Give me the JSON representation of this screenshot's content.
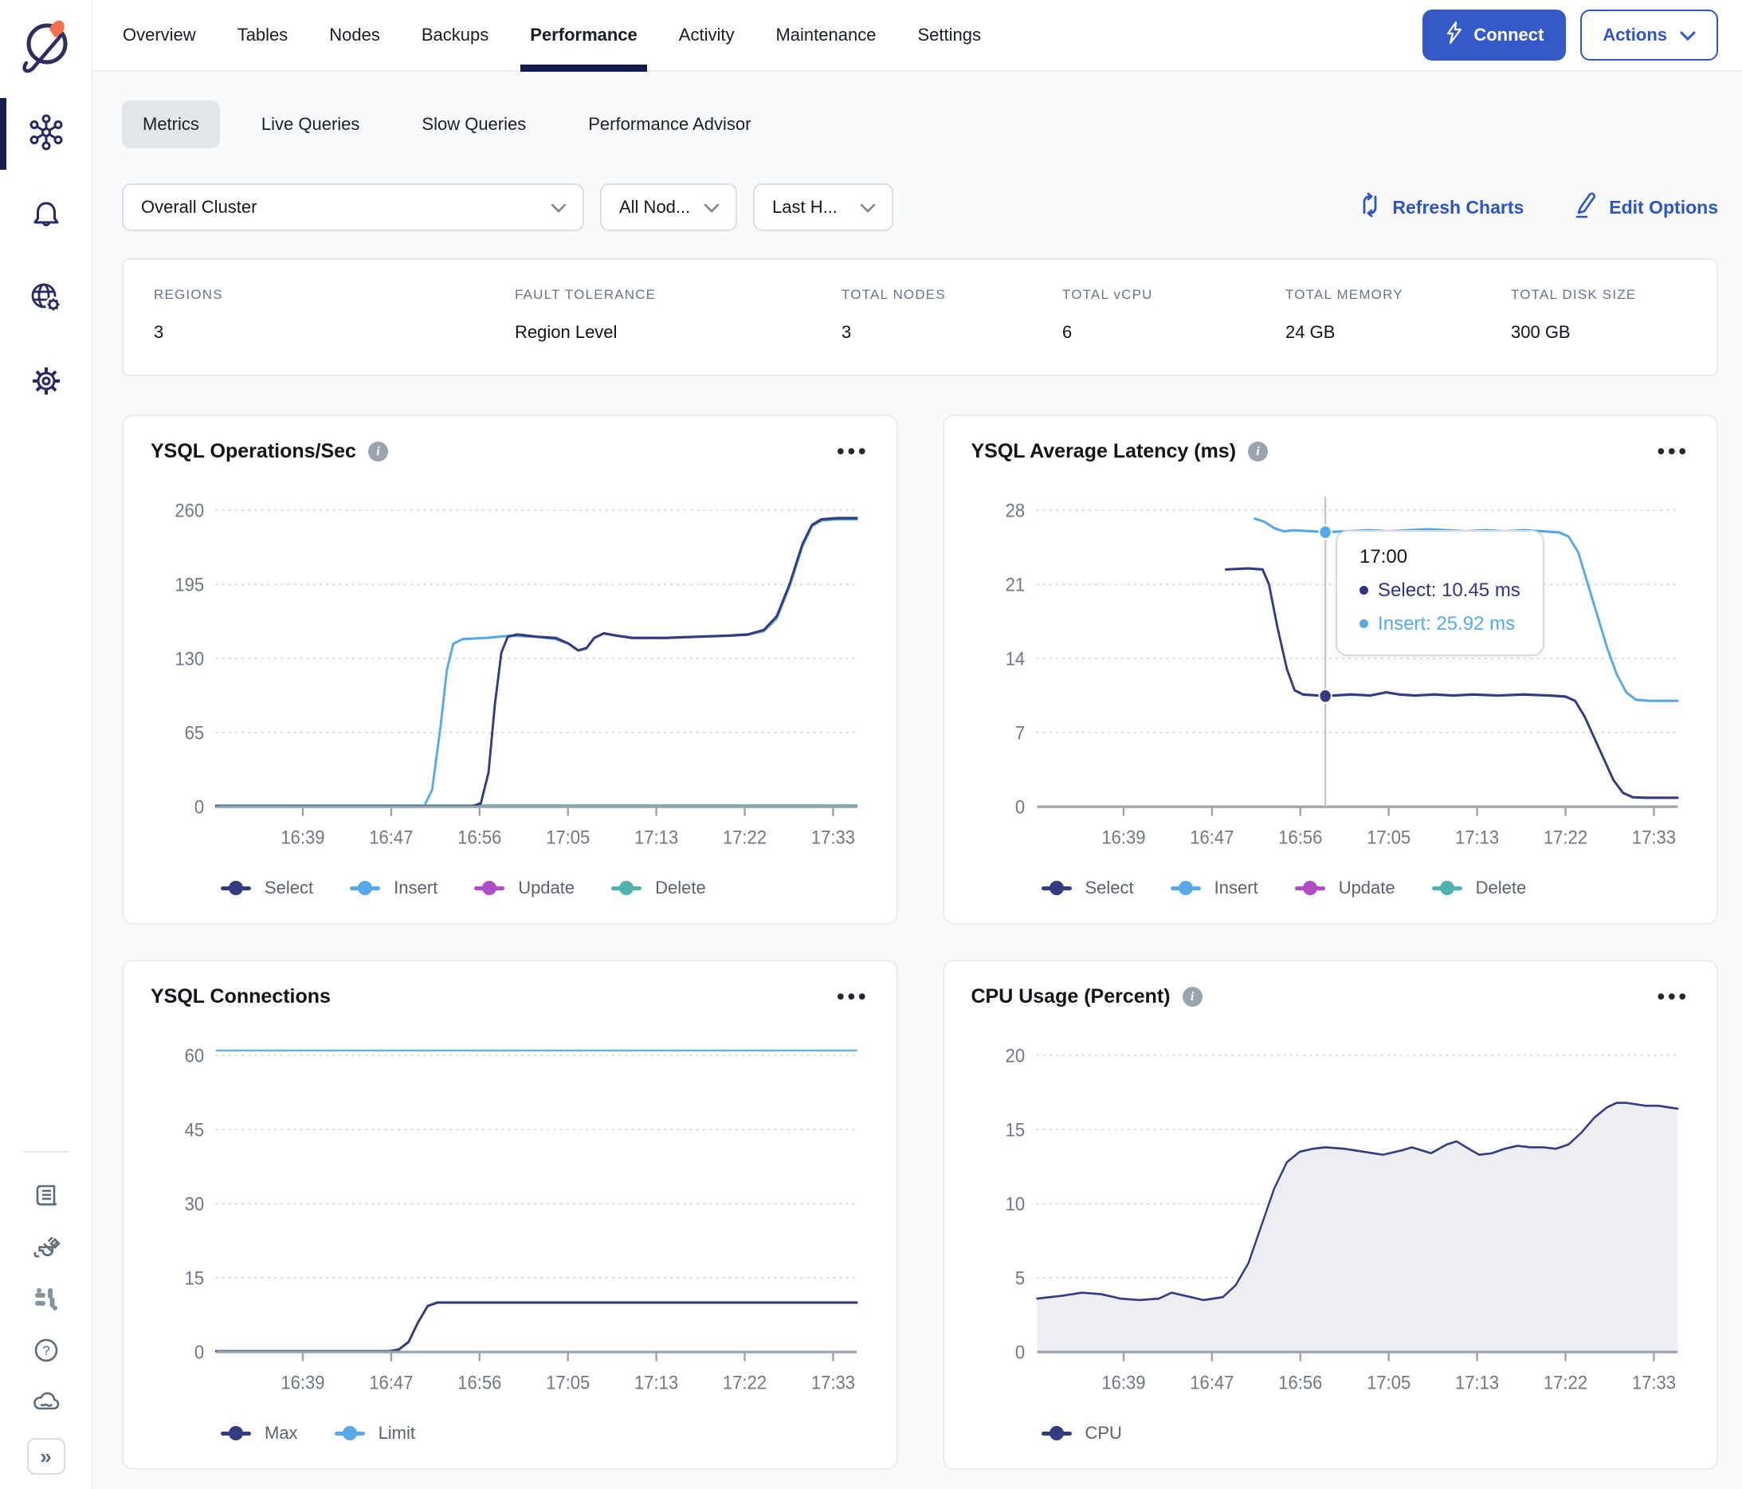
{
  "nav": {
    "tabs": [
      {
        "label": "Overview"
      },
      {
        "label": "Tables"
      },
      {
        "label": "Nodes"
      },
      {
        "label": "Backups"
      },
      {
        "label": "Performance"
      },
      {
        "label": "Activity"
      },
      {
        "label": "Maintenance"
      },
      {
        "label": "Settings"
      }
    ],
    "active_tab": "Performance",
    "connect_label": "Connect",
    "actions_label": "Actions"
  },
  "subtabs": {
    "items": [
      {
        "label": "Metrics"
      },
      {
        "label": "Live Queries"
      },
      {
        "label": "Slow Queries"
      },
      {
        "label": "Performance Advisor"
      }
    ],
    "active": "Metrics"
  },
  "filters": {
    "cluster_scope": "Overall Cluster",
    "nodes": "All Nod...",
    "time_range": "Last H...",
    "refresh_label": "Refresh Charts",
    "edit_label": "Edit Options"
  },
  "summary": [
    {
      "label": "REGIONS",
      "value": "3"
    },
    {
      "label": "FAULT TOLERANCE",
      "value": "Region Level"
    },
    {
      "label": "TOTAL NODES",
      "value": "3"
    },
    {
      "label": "TOTAL vCPU",
      "value": "6"
    },
    {
      "label": "TOTAL MEMORY",
      "value": "24 GB"
    },
    {
      "label": "TOTAL DISK SIZE",
      "value": "300 GB"
    }
  ],
  "colors": {
    "accent_blue": "#3254c5",
    "navy_series": "#343b80",
    "insert_blue": "#58a9e9",
    "update_magenta": "#b14bc6",
    "delete_teal": "#4fb3ad",
    "grid": "#d9dde1",
    "baseline": "#9aa3ae",
    "axis_text": "#6f7884",
    "cpu_fill": "#ededf4"
  },
  "chart_data": [
    {
      "type": "line",
      "title": "YSQL Operations/Sec",
      "info_icon": true,
      "ylim": [
        0,
        260
      ],
      "yticks": [
        0,
        65,
        130,
        195,
        260
      ],
      "xticks": [
        "16:39",
        "16:47",
        "16:56",
        "17:05",
        "17:13",
        "17:22",
        "17:33"
      ],
      "xtick_fracs": [
        0.135,
        0.273,
        0.411,
        0.549,
        0.687,
        0.825,
        0.963
      ],
      "grid": "dotted",
      "legend_position": "bottom",
      "series": [
        {
          "name": "Update",
          "color": "#b14bc6",
          "width": 2.5,
          "points": [
            [
              0,
              0.5
            ],
            [
              1,
              0.5
            ]
          ]
        },
        {
          "name": "Delete",
          "color": "#4fb3ad",
          "width": 2.5,
          "points": [
            [
              0,
              1.2
            ],
            [
              1,
              1.2
            ]
          ]
        },
        {
          "name": "Insert",
          "color": "#58a9e9",
          "width": 3,
          "points": [
            [
              0,
              1
            ],
            [
              0.325,
              1
            ],
            [
              0.337,
              15
            ],
            [
              0.35,
              70
            ],
            [
              0.36,
              120
            ],
            [
              0.37,
              143
            ],
            [
              0.385,
              147
            ],
            [
              0.42,
              148
            ],
            [
              0.46,
              150
            ],
            [
              0.5,
              149
            ],
            [
              0.53,
              147
            ],
            [
              0.55,
              143
            ],
            [
              0.565,
              137
            ],
            [
              0.578,
              139
            ],
            [
              0.59,
              148
            ],
            [
              0.605,
              152
            ],
            [
              0.625,
              150
            ],
            [
              0.65,
              148
            ],
            [
              0.7,
              148
            ],
            [
              0.75,
              149
            ],
            [
              0.8,
              150
            ],
            [
              0.83,
              151
            ],
            [
              0.855,
              154
            ],
            [
              0.875,
              165
            ],
            [
              0.895,
              193
            ],
            [
              0.915,
              228
            ],
            [
              0.93,
              246
            ],
            [
              0.945,
              251
            ],
            [
              0.97,
              252
            ],
            [
              1,
              252
            ]
          ]
        },
        {
          "name": "Select",
          "color": "#343b80",
          "width": 3,
          "points": [
            [
              0,
              0.4
            ],
            [
              0.4,
              0.4
            ],
            [
              0.413,
              3
            ],
            [
              0.425,
              30
            ],
            [
              0.435,
              90
            ],
            [
              0.445,
              135
            ],
            [
              0.455,
              149
            ],
            [
              0.47,
              151
            ],
            [
              0.5,
              149
            ],
            [
              0.53,
              148
            ],
            [
              0.55,
              143
            ],
            [
              0.565,
              137
            ],
            [
              0.578,
              139
            ],
            [
              0.59,
              148
            ],
            [
              0.605,
              152
            ],
            [
              0.625,
              150
            ],
            [
              0.65,
              148
            ],
            [
              0.7,
              148
            ],
            [
              0.75,
              149
            ],
            [
              0.8,
              150
            ],
            [
              0.83,
              151
            ],
            [
              0.855,
              155
            ],
            [
              0.875,
              167
            ],
            [
              0.895,
              195
            ],
            [
              0.915,
              230
            ],
            [
              0.93,
              247
            ],
            [
              0.945,
              252
            ],
            [
              0.97,
              253
            ],
            [
              1,
              253
            ]
          ]
        }
      ]
    },
    {
      "type": "line",
      "title": "YSQL Average Latency (ms)",
      "info_icon": true,
      "ylim": [
        0,
        28
      ],
      "yticks": [
        0,
        7,
        14,
        21,
        28
      ],
      "xticks": [
        "16:39",
        "16:47",
        "16:56",
        "17:05",
        "17:13",
        "17:22",
        "17:33"
      ],
      "xtick_fracs": [
        0.135,
        0.273,
        0.411,
        0.549,
        0.687,
        0.825,
        0.963
      ],
      "grid": "dotted",
      "legend_position": "bottom",
      "series": [
        {
          "name": "Select",
          "color": "#343b80",
          "width": 3,
          "points": [
            [
              0.295,
              22.4
            ],
            [
              0.33,
              22.5
            ],
            [
              0.352,
              22.4
            ],
            [
              0.362,
              21
            ],
            [
              0.375,
              17
            ],
            [
              0.39,
              13
            ],
            [
              0.402,
              11
            ],
            [
              0.415,
              10.6
            ],
            [
              0.45,
              10.45
            ],
            [
              0.49,
              10.6
            ],
            [
              0.52,
              10.5
            ],
            [
              0.545,
              10.8
            ],
            [
              0.565,
              10.6
            ],
            [
              0.59,
              10.5
            ],
            [
              0.62,
              10.6
            ],
            [
              0.65,
              10.5
            ],
            [
              0.68,
              10.6
            ],
            [
              0.72,
              10.5
            ],
            [
              0.76,
              10.6
            ],
            [
              0.8,
              10.5
            ],
            [
              0.825,
              10.4
            ],
            [
              0.84,
              10
            ],
            [
              0.855,
              8.5
            ],
            [
              0.87,
              6.5
            ],
            [
              0.885,
              4.5
            ],
            [
              0.9,
              2.5
            ],
            [
              0.915,
              1.3
            ],
            [
              0.93,
              0.9
            ],
            [
              0.95,
              0.85
            ],
            [
              1,
              0.85
            ]
          ]
        },
        {
          "name": "Insert",
          "color": "#58a9e9",
          "width": 3,
          "points": [
            [
              0.34,
              27.2
            ],
            [
              0.355,
              26.9
            ],
            [
              0.37,
              26.3
            ],
            [
              0.385,
              26.0
            ],
            [
              0.4,
              26.1
            ],
            [
              0.43,
              26.0
            ],
            [
              0.45,
              25.92
            ],
            [
              0.48,
              26.0
            ],
            [
              0.52,
              26.1
            ],
            [
              0.55,
              26.0
            ],
            [
              0.58,
              26.1
            ],
            [
              0.61,
              26.2
            ],
            [
              0.64,
              26.1
            ],
            [
              0.67,
              26.0
            ],
            [
              0.7,
              26.1
            ],
            [
              0.73,
              26.0
            ],
            [
              0.76,
              26.1
            ],
            [
              0.79,
              26.0
            ],
            [
              0.815,
              25.9
            ],
            [
              0.83,
              25.5
            ],
            [
              0.845,
              24
            ],
            [
              0.86,
              21
            ],
            [
              0.875,
              18
            ],
            [
              0.89,
              15
            ],
            [
              0.905,
              12.5
            ],
            [
              0.92,
              10.8
            ],
            [
              0.935,
              10.1
            ],
            [
              0.955,
              10
            ],
            [
              1,
              10
            ]
          ]
        },
        {
          "name": "Update",
          "color": "#b14bc6",
          "width": 2.5,
          "points": []
        },
        {
          "name": "Delete",
          "color": "#4fb3ad",
          "width": 2.5,
          "points": []
        }
      ],
      "cursor": {
        "x": 0.45,
        "dots": [
          {
            "y": 25.92,
            "color": "#58a9e9"
          },
          {
            "y": 10.45,
            "color": "#343b80"
          }
        ],
        "tooltip": {
          "time": "17:00",
          "rows": [
            {
              "label": "Select",
              "value": "10.45 ms",
              "color": "#2d3484"
            },
            {
              "label": "Insert",
              "value": "25.92 ms",
              "color": "#58a9e9"
            }
          ]
        }
      }
    },
    {
      "type": "line",
      "title": "YSQL Connections",
      "info_icon": false,
      "ylim": [
        0,
        60
      ],
      "yticks": [
        0,
        15,
        30,
        45,
        60
      ],
      "xticks": [
        "16:39",
        "16:47",
        "16:56",
        "17:05",
        "17:13",
        "17:22",
        "17:33"
      ],
      "xtick_fracs": [
        0.135,
        0.273,
        0.411,
        0.549,
        0.687,
        0.825,
        0.963
      ],
      "grid": "dotted",
      "legend_position": "bottom",
      "series": [
        {
          "name": "Max",
          "color": "#343b80",
          "width": 3,
          "points": [
            [
              0,
              0.15
            ],
            [
              0.27,
              0.15
            ],
            [
              0.285,
              0.5
            ],
            [
              0.3,
              2
            ],
            [
              0.315,
              6
            ],
            [
              0.33,
              9.3
            ],
            [
              0.345,
              10
            ],
            [
              1,
              10
            ]
          ]
        },
        {
          "name": "Limit",
          "color": "#58a9e9",
          "width": 2,
          "points": [
            [
              0,
              61
            ],
            [
              1,
              61
            ]
          ]
        }
      ]
    },
    {
      "type": "area",
      "title": "CPU Usage (Percent)",
      "info_icon": true,
      "ylim": [
        0,
        20
      ],
      "yticks": [
        0,
        5,
        10,
        15,
        20
      ],
      "xticks": [
        "16:39",
        "16:47",
        "16:56",
        "17:05",
        "17:13",
        "17:22",
        "17:33"
      ],
      "xtick_fracs": [
        0.135,
        0.273,
        0.411,
        0.549,
        0.687,
        0.825,
        0.963
      ],
      "grid": "dotted",
      "legend_position": "bottom",
      "series": [
        {
          "name": "CPU",
          "color": "#343b80",
          "width": 2.5,
          "fill": "#ededf4",
          "points": [
            [
              0,
              3.6
            ],
            [
              0.04,
              3.8
            ],
            [
              0.07,
              4.0
            ],
            [
              0.1,
              3.9
            ],
            [
              0.13,
              3.6
            ],
            [
              0.16,
              3.5
            ],
            [
              0.19,
              3.6
            ],
            [
              0.21,
              4.0
            ],
            [
              0.23,
              3.8
            ],
            [
              0.26,
              3.5
            ],
            [
              0.29,
              3.7
            ],
            [
              0.31,
              4.5
            ],
            [
              0.33,
              6
            ],
            [
              0.35,
              8.5
            ],
            [
              0.37,
              11
            ],
            [
              0.39,
              12.8
            ],
            [
              0.41,
              13.5
            ],
            [
              0.43,
              13.7
            ],
            [
              0.45,
              13.8
            ],
            [
              0.48,
              13.7
            ],
            [
              0.51,
              13.5
            ],
            [
              0.54,
              13.3
            ],
            [
              0.57,
              13.6
            ],
            [
              0.585,
              13.8
            ],
            [
              0.6,
              13.6
            ],
            [
              0.615,
              13.4
            ],
            [
              0.64,
              14.0
            ],
            [
              0.655,
              14.2
            ],
            [
              0.67,
              13.8
            ],
            [
              0.69,
              13.3
            ],
            [
              0.71,
              13.4
            ],
            [
              0.73,
              13.7
            ],
            [
              0.75,
              13.9
            ],
            [
              0.77,
              13.8
            ],
            [
              0.79,
              13.8
            ],
            [
              0.81,
              13.7
            ],
            [
              0.83,
              14.0
            ],
            [
              0.85,
              14.8
            ],
            [
              0.87,
              15.8
            ],
            [
              0.89,
              16.5
            ],
            [
              0.905,
              16.8
            ],
            [
              0.92,
              16.8
            ],
            [
              0.95,
              16.6
            ],
            [
              0.97,
              16.6
            ],
            [
              1,
              16.4
            ]
          ]
        }
      ]
    }
  ]
}
